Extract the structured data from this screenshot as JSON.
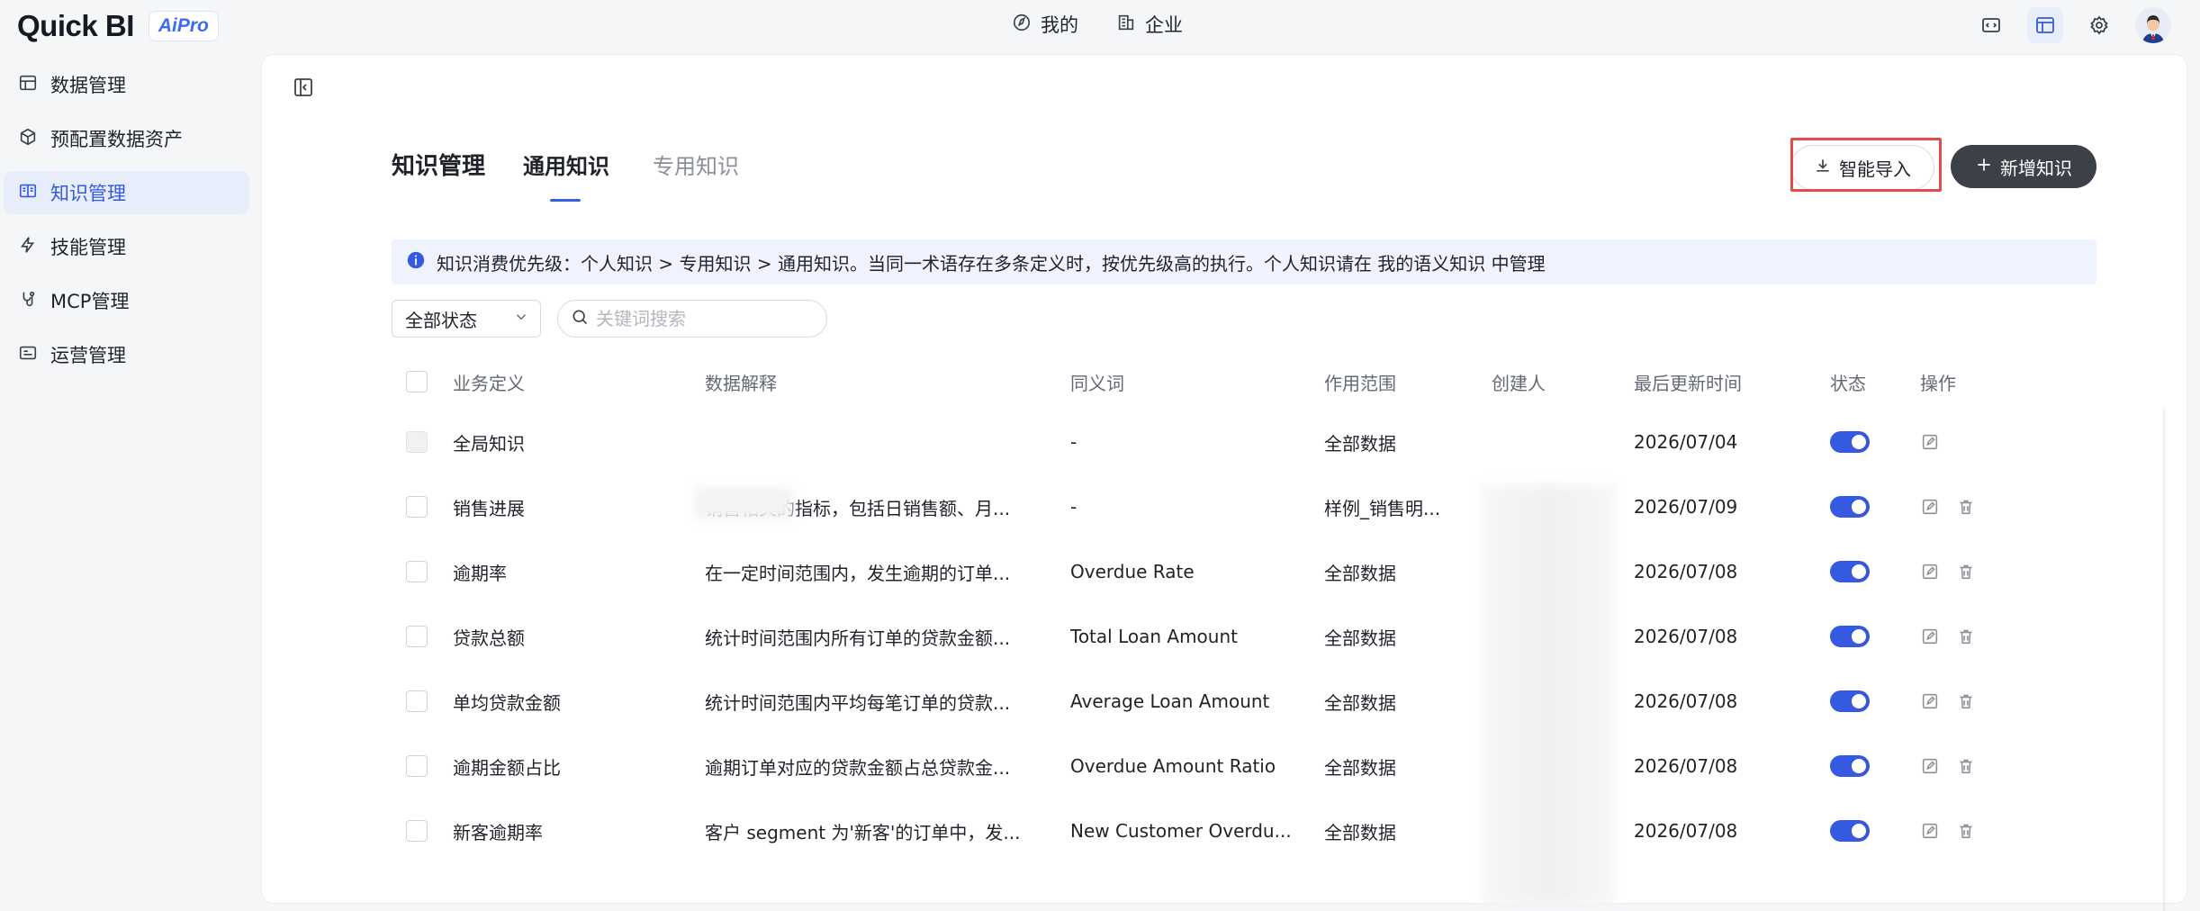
{
  "app": {
    "logo_text": "Quick BI",
    "logo_badge": "AiPro"
  },
  "topnav": {
    "mine_label": "我的",
    "enterprise_label": "企业"
  },
  "sidebar": {
    "items": [
      {
        "label": "数据管理",
        "icon": "data-table-icon"
      },
      {
        "label": "预配置数据资产",
        "icon": "cube-icon"
      },
      {
        "label": "知识管理",
        "icon": "book-icon",
        "active": true
      },
      {
        "label": "技能管理",
        "icon": "lightning-icon"
      },
      {
        "label": "MCP管理",
        "icon": "plug-icon"
      },
      {
        "label": "运营管理",
        "icon": "operations-icon"
      }
    ]
  },
  "header": {
    "title": "知识管理",
    "tabs": [
      {
        "label": "通用知识",
        "active": true
      },
      {
        "label": "专用知识",
        "active": false
      }
    ],
    "import_label": "智能导入",
    "new_label": "新增知识"
  },
  "notice": {
    "text": "知识消费优先级：个人知识 > 专用知识 > 通用知识。当同一术语存在多条定义时，按优先级高的执行。个人知识请在 我的语义知识 中管理"
  },
  "filters": {
    "status_value": "全部状态",
    "search_placeholder": "关键词搜索"
  },
  "table": {
    "columns": [
      "业务定义",
      "数据解释",
      "同义词",
      "作用范围",
      "创建人",
      "最后更新时间",
      "状态",
      "操作"
    ],
    "rows": [
      {
        "name": "全局知识",
        "desc": "",
        "synonym": "-",
        "scope": "全部数据",
        "creator": "",
        "updated": "2026/07/04",
        "enabled": true,
        "deletable": false
      },
      {
        "name": "销售进展",
        "desc": "销售相关的指标，包括日销售额、月...",
        "synonym": "-",
        "scope": "样例_销售明...",
        "creator": "",
        "updated": "2026/07/09",
        "enabled": true,
        "deletable": true
      },
      {
        "name": "逾期率",
        "desc": "在一定时间范围内，发生逾期的订单...",
        "synonym": "Overdue Rate",
        "scope": "全部数据",
        "creator": "",
        "updated": "2026/07/08",
        "enabled": true,
        "deletable": true
      },
      {
        "name": "贷款总额",
        "desc": "统计时间范围内所有订单的贷款金额...",
        "synonym": "Total Loan Amount",
        "scope": "全部数据",
        "creator": "",
        "updated": "2026/07/08",
        "enabled": true,
        "deletable": true
      },
      {
        "name": "单均贷款金额",
        "desc": "统计时间范围内平均每笔订单的贷款...",
        "synonym": "Average Loan Amount",
        "scope": "全部数据",
        "creator": "",
        "updated": "2026/07/08",
        "enabled": true,
        "deletable": true
      },
      {
        "name": "逾期金额占比",
        "desc": "逾期订单对应的贷款金额占总贷款金...",
        "synonym": "Overdue Amount Ratio",
        "scope": "全部数据",
        "creator": "",
        "updated": "2026/07/08",
        "enabled": true,
        "deletable": true
      },
      {
        "name": "新客逾期率",
        "desc": "客户 segment 为'新客'的订单中，发...",
        "synonym": "New Customer Overdu...",
        "scope": "全部数据",
        "creator": "",
        "updated": "2026/07/08",
        "enabled": true,
        "deletable": true
      }
    ]
  },
  "colors": {
    "accent": "#3559e0",
    "highlight": "#e34c4c",
    "primary_button": "#3c4048"
  }
}
